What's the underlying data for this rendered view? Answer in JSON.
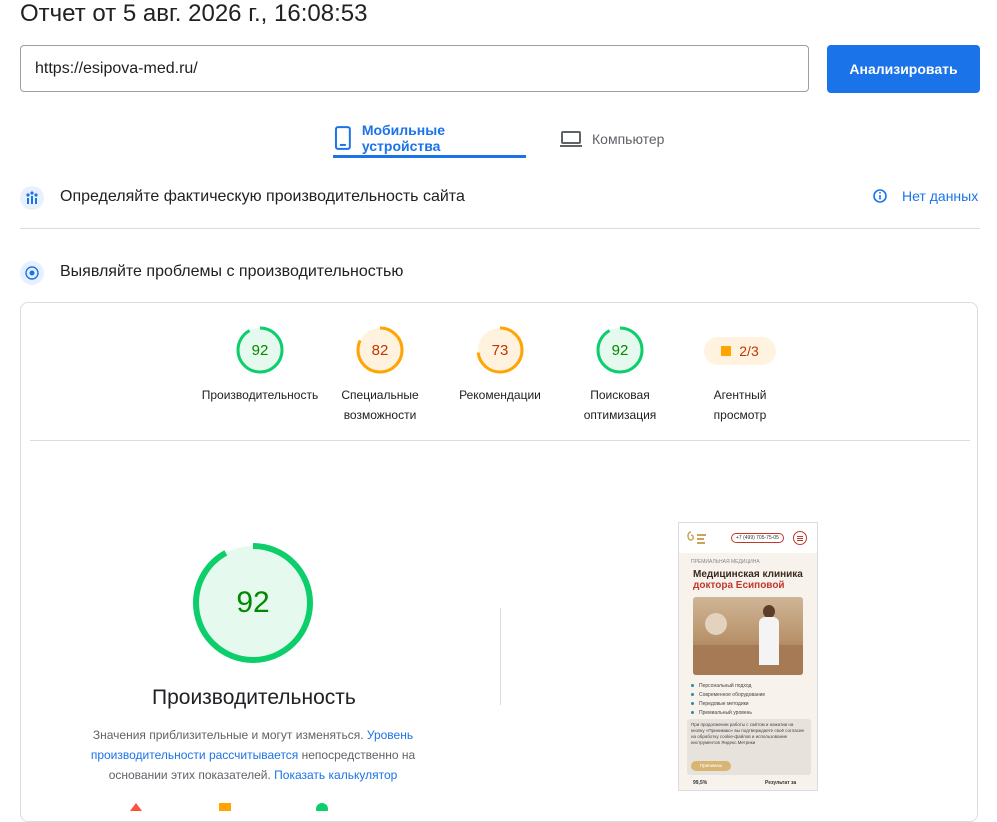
{
  "report": {
    "title": "Отчет от 5 авг. 2026 г., 16:08:53"
  },
  "search": {
    "url": "https://esipova-med.ru/",
    "analyze_label": "Анализировать"
  },
  "tabs": [
    {
      "label": "Мобильные устройства"
    },
    {
      "label": "Компьютер"
    }
  ],
  "sections": {
    "field": {
      "title": "Определяйте фактическую производительность сайта",
      "status": "Нет данных"
    },
    "lab": {
      "title": "Выявляйте проблемы с производительностью"
    }
  },
  "scores": [
    {
      "value": "92",
      "label_line1": "Производительность",
      "label_line2": "",
      "color": "#0cce6b",
      "text_color": "#008800",
      "fill": 0.92
    },
    {
      "value": "82",
      "label_line1": "Специальные",
      "label_line2": "возможности",
      "color": "#ffa400",
      "text_color": "#c33300",
      "fill": 0.82
    },
    {
      "value": "73",
      "label_line1": "Рекомендации",
      "label_line2": "",
      "color": "#ffa400",
      "text_color": "#c33300",
      "fill": 0.73
    },
    {
      "value": "92",
      "label_line1": "Поисковая",
      "label_line2": "оптимизация",
      "color": "#0cce6b",
      "text_color": "#008800",
      "fill": 0.92
    }
  ],
  "agent": {
    "value": "2/3",
    "label_line1": "Агентный",
    "label_line2": "просмотр"
  },
  "performance": {
    "score": "92",
    "fill": 0.92,
    "title": "Производительность",
    "desc_part1": "Значения приблизительные и могут изменяться. ",
    "desc_link1": "Уровень производительности рассчитывается",
    "desc_part2": " непосредственно на основании этих показателей. ",
    "desc_link2": "Показать калькулятор"
  },
  "screenshot": {
    "phone": "+7 (499) 705-75-05",
    "tag": "ПРЕМИАЛЬНАЯ МЕДИЦИНА",
    "heading1": "Медицинская клиника",
    "heading2": "доктора Есиповой",
    "bullets": [
      "Персональный подход",
      "Современное оборудование",
      "Передовые методики",
      "Премиальный уровень"
    ],
    "cookie": "При продолжении работы с сайтом и нажатии на кнопку «Принимаю» вы подтверждаете своё согласие на обработку cookie-файлов и использование инструментов Яндекс.Метрики",
    "accept": "Принимаю",
    "stat1": "99,5%",
    "stat2": "Результат за"
  },
  "colors": {
    "accent": "#1a73e8",
    "pass": "#0cce6b",
    "average": "#ffa400"
  }
}
